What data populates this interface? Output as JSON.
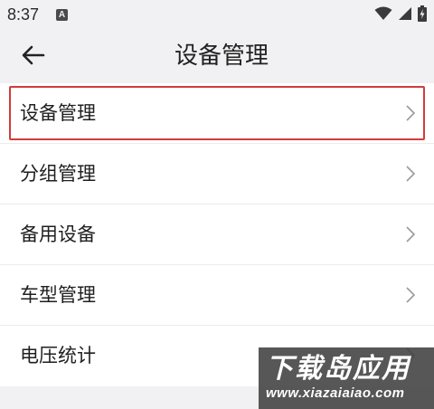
{
  "status_bar": {
    "time": "8:37",
    "notification_icon": "a-letter-icon",
    "wifi_icon": "wifi-icon",
    "signal_icon": "signal-icon",
    "battery_icon": "battery-charging-icon"
  },
  "header": {
    "back_icon": "arrow-left-icon",
    "title": "设备管理"
  },
  "menu": {
    "items": [
      {
        "label": "设备管理",
        "highlighted": true
      },
      {
        "label": "分组管理"
      },
      {
        "label": "备用设备"
      },
      {
        "label": "车型管理"
      },
      {
        "label": "电压统计"
      }
    ]
  },
  "watermark": {
    "title": "下载岛应用",
    "url": "www.xiazaiaiao.com"
  },
  "colors": {
    "background": "#f1f1f3",
    "list_background": "#ffffff",
    "highlight_border": "#d43b3b",
    "chevron": "#9a9a9a"
  }
}
